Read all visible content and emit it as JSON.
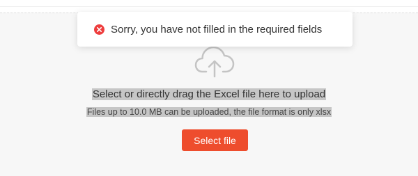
{
  "toast": {
    "type": "error",
    "icon": "error-circle-icon",
    "message": "Sorry, you have not filled in the required fields",
    "icon_color": "#ee3e3e"
  },
  "upload": {
    "icon": "cloud-upload-icon",
    "instruction": "Select or directly drag the Excel file here to upload",
    "hint": "Files up to 10.0 MB can be uploaded, the file format is only xlsx",
    "button_label": "Select file",
    "button_color": "#ee4d2d"
  }
}
